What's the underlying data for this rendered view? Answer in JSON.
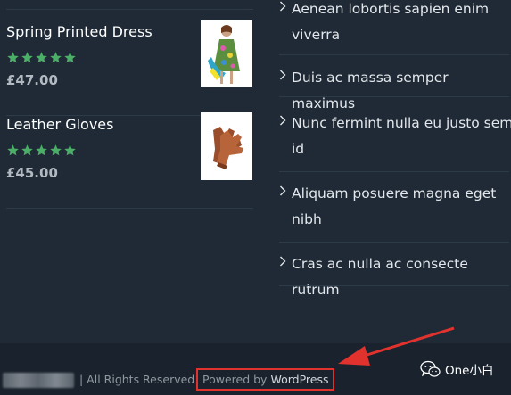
{
  "products": [
    {
      "title": "Spring Printed Dress",
      "price": "£47.00",
      "rating": 5
    },
    {
      "title": "Leather Gloves",
      "price": "£45.00",
      "rating": 5
    }
  ],
  "recent_posts": [
    {
      "title": "Aenean lobortis sapien enim viverra"
    },
    {
      "title": "Duis ac massa semper maximus"
    },
    {
      "title": "Nunc fermint nulla eu justo sem id"
    },
    {
      "title": "Aliquam posuere magna eget nibh"
    },
    {
      "title": "Cras ac nulla ac consecte rutrum"
    }
  ],
  "footer": {
    "copyright": "| All Rights Reserved",
    "powered_prefix": "Powered by ",
    "powered_link": "WordPress"
  },
  "watermark": {
    "text": "One小白",
    "icon": "wechat-icon"
  },
  "colors": {
    "background": "#1f2a36",
    "footer_bg": "#1a232d",
    "star": "#4caf67",
    "highlight": "#e2322e"
  }
}
